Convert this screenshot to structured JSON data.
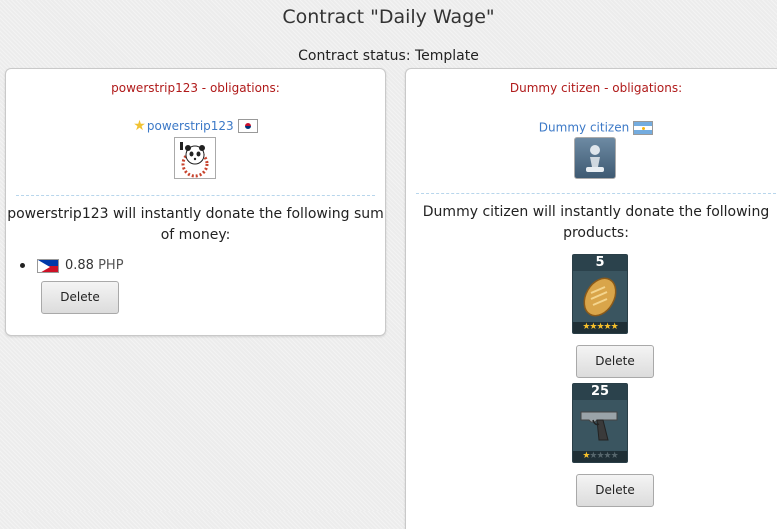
{
  "header": {
    "title": "Contract \"Daily Wage\"",
    "status": "Contract status: Template"
  },
  "left": {
    "obligations_title": "powerstrip123 - obligations:",
    "citizen_name": "powerstrip123",
    "citizen_flag": "south-korea-flag-icon",
    "avatar_icon": "panda-avatar",
    "donate_text": "powerstrip123 will instantly donate the following sum of money:",
    "money": {
      "amount": "0.88",
      "currency": "PHP",
      "flag": "philippines-flag-icon"
    },
    "delete_label": "Delete"
  },
  "right": {
    "obligations_title": "Dummy citizen - obligations:",
    "citizen_name": "Dummy citizen",
    "citizen_flag": "argentina-flag-icon",
    "avatar_icon": "pawn-avatar",
    "donate_text": "Dummy citizen will instantly donate the following products:",
    "products": [
      {
        "count": "5",
        "icon": "bread-icon",
        "quality": 5,
        "delete_label": "Delete"
      },
      {
        "count": "25",
        "icon": "pistol-icon",
        "quality": 1,
        "delete_label": "Delete"
      }
    ]
  },
  "colors": {
    "obligation_red": "#b01a1a",
    "link_blue": "#3c79c7"
  }
}
